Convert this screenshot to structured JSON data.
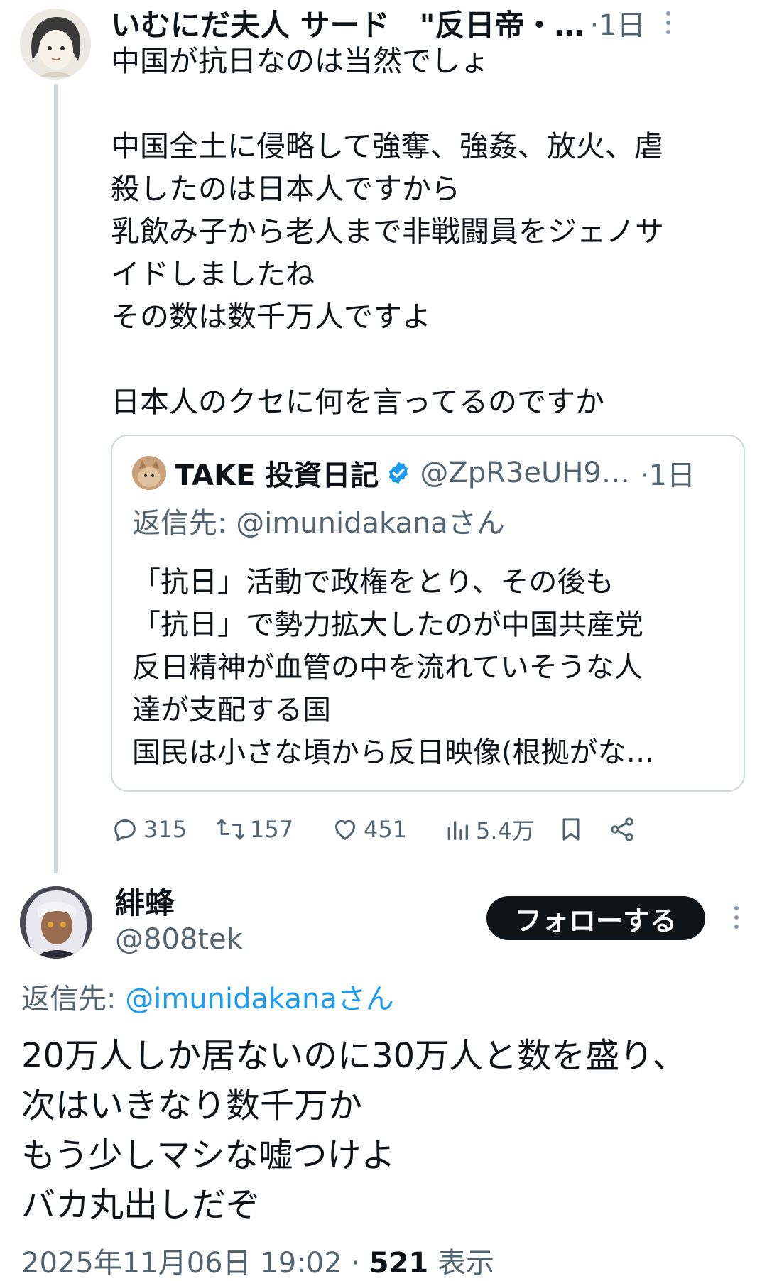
{
  "tweet1": {
    "display_name": "いむにだ夫人 サード　\"反日帝・…",
    "time": "·1日",
    "body_lines": [
      "中国が抗日なのは当然でしょ",
      "",
      "中国全土に侵略して強奪、強姦、放火、虐",
      "殺したのは日本人ですから",
      "乳飲み子から老人まで非戦闘員をジェノサ",
      "イドしましたね",
      "その数は数千万人ですよ",
      "",
      "日本人のクセに何を言ってるのですか"
    ],
    "quote": {
      "display_name": "TAKE 投資日記",
      "handle": "@ZpR3eUH9…",
      "time": "·1日",
      "reply_label": "返信先: @imunidakanaさん",
      "body_lines": [
        "「抗日」活動で政権をとり、その後も",
        "「抗日」で勢力拡大したのが中国共産党",
        "反日精神が血管の中を流れていそうな人",
        "達が支配する国",
        "国民は小さな頃から反日映像(根拠がな…"
      ]
    },
    "actions": {
      "replies": "315",
      "retweets": "157",
      "likes": "451",
      "views": "5.4万"
    }
  },
  "tweet2": {
    "display_name": "緋蜂",
    "handle": "@808tek",
    "follow_label": "フォローする",
    "reply_prefix": "返信先: ",
    "reply_handle": "@imunidakanaさん",
    "body_lines": [
      "20万人しか居ないのに30万人と数を盛り、",
      "次はいきなり数千万か",
      "もう少しマシな嘘つけよ",
      "バカ丸出しだぞ"
    ],
    "timestamp": "2025年11月06日 19:02 · ",
    "view_count": "521",
    "view_label": " 表示"
  },
  "colors": {
    "text": "#0f1419",
    "muted": "#536471",
    "link": "#1d9bf0",
    "verified": "#1d9bf0",
    "border": "#cfd9de",
    "follow_bg": "#0f1419"
  }
}
